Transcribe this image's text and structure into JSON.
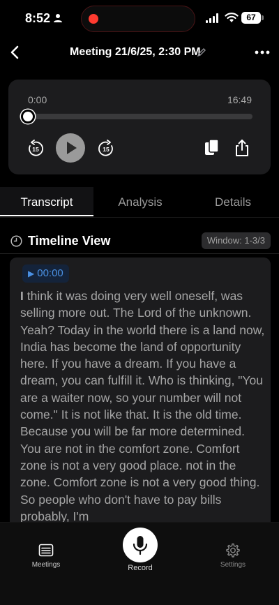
{
  "status_bar": {
    "time": "8:52",
    "battery": "67"
  },
  "header": {
    "title": "Meeting 21/6/25, 2:30 PM"
  },
  "player": {
    "current_time": "0:00",
    "duration": "16:49",
    "progress": 0,
    "skip_back_seconds": "15",
    "skip_forward_seconds": "15"
  },
  "tabs": [
    {
      "label": "Transcript",
      "active": true
    },
    {
      "label": "Analysis",
      "active": false
    },
    {
      "label": "Details",
      "active": false
    }
  ],
  "timeline": {
    "title": "Timeline View",
    "window_label": "Window: 1-3/3"
  },
  "transcript": {
    "timestamp": "00:00",
    "first_char": "I",
    "text": " think it was doing very well oneself, was selling more out. The Lord of the unknown. Yeah? Today in the world there is a land now, India has become the land of opportunity here. If you have a dream. If you have a dream, you can fulfill it. Who is thinking, \"You are a waiter now, so your number will not come.\" It is not like that. It is the old time. Because you will be far more determined. You are not in the comfort zone. Comfort zone is not a very good place. not in the zone. Comfort zone is not a very good thing. So people who don't have to pay bills probably, I'm"
  },
  "bottom_nav": {
    "meetings_label": "Meetings",
    "record_label": "Record",
    "settings_label": "Settings"
  },
  "colors": {
    "accent_blue": "#4a90e2",
    "record_red": "#ff3b30",
    "card_bg": "#1c1c1e"
  }
}
